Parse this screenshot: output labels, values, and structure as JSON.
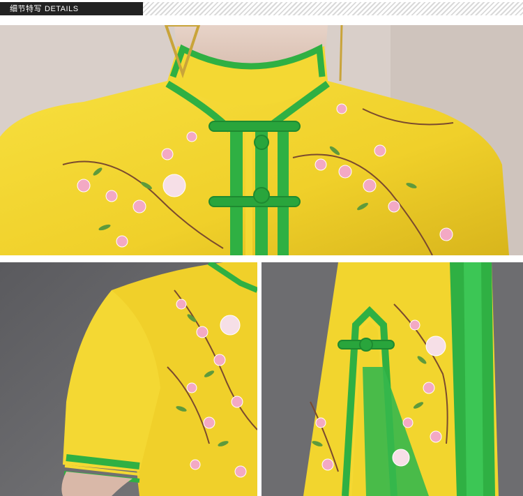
{
  "header": {
    "title_cn": "细节特写",
    "title_en": "DETAILS"
  },
  "colors": {
    "fabric_yellow": "#f2d52e",
    "trim_green": "#2fb043",
    "blossom_pink": "#f3a9c4",
    "leaf_green": "#5e9a3c",
    "background_gray": "#6d6d70"
  }
}
